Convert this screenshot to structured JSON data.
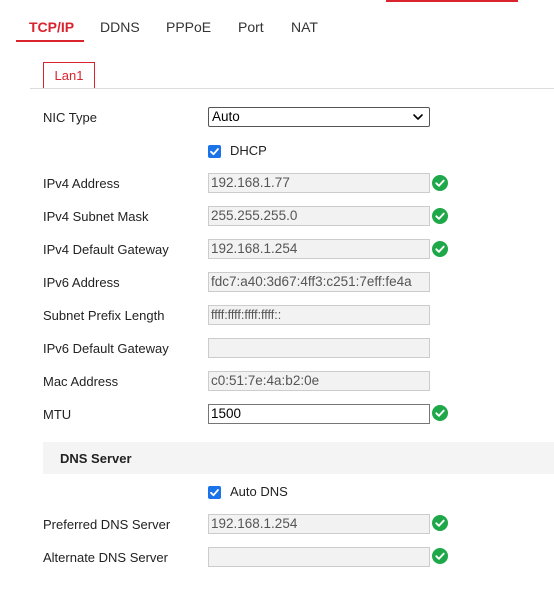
{
  "tabs": [
    {
      "label": "TCP/IP",
      "active": true
    },
    {
      "label": "DDNS",
      "active": false
    },
    {
      "label": "PPPoE",
      "active": false
    },
    {
      "label": "Port",
      "active": false
    },
    {
      "label": "NAT",
      "active": false
    }
  ],
  "lan_tab": {
    "label": "Lan1"
  },
  "form": {
    "nic_type": {
      "label": "NIC Type",
      "value": "Auto"
    },
    "dhcp": {
      "label": "DHCP",
      "checked": true
    },
    "ipv4_address": {
      "label": "IPv4 Address",
      "value": "192.168.1.77",
      "valid": true
    },
    "ipv4_subnet_mask": {
      "label": "IPv4 Subnet Mask",
      "value": "255.255.255.0",
      "valid": true
    },
    "ipv4_default_gateway": {
      "label": "IPv4 Default Gateway",
      "value": "192.168.1.254",
      "valid": true
    },
    "ipv6_address": {
      "label": "IPv6 Address",
      "value": "fdc7:a40:3d67:4ff3:c251:7eff:fe4a"
    },
    "subnet_prefix_length": {
      "label": "Subnet Prefix Length",
      "value": "ffff:ffff:ffff:ffff::"
    },
    "ipv6_default_gateway": {
      "label": "IPv6 Default Gateway",
      "value": ""
    },
    "mac_address": {
      "label": "Mac Address",
      "value": "c0:51:7e:4a:b2:0e"
    },
    "mtu": {
      "label": "MTU",
      "value": "1500",
      "valid": true
    }
  },
  "dns": {
    "section_title": "DNS Server",
    "auto_dns": {
      "label": "Auto DNS",
      "checked": true
    },
    "preferred": {
      "label": "Preferred DNS Server",
      "value": "192.168.1.254",
      "valid": true
    },
    "alternate": {
      "label": "Alternate DNS Server",
      "value": "",
      "valid": true
    }
  },
  "colors": {
    "accent": "#d9232d",
    "checkbox": "#1a73e8",
    "valid": "#1fa84a"
  },
  "icons": {
    "valid": "check-circle-icon",
    "dropdown": "chevron-down-icon"
  }
}
